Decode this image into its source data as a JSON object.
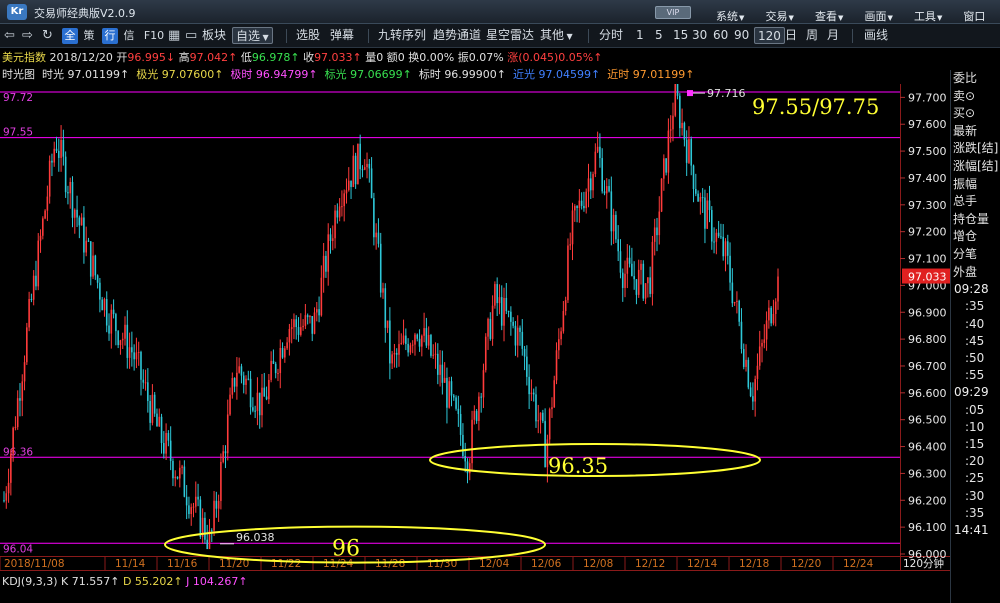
{
  "window": {
    "app_title": "交易师经典版V2.0.9",
    "logo_text": "Kr",
    "vip": "VIP",
    "menu": [
      "系统",
      "交易",
      "查看",
      "画面",
      "工具",
      "窗口"
    ]
  },
  "toolbar": {
    "tabs": [
      "全",
      "策",
      "行",
      "信",
      "F10"
    ],
    "buttons": [
      "板块",
      "自选",
      "选股",
      "弹幕",
      "九转序列",
      "趋势通道",
      "星空雷达",
      "其他"
    ],
    "periods": [
      "分时",
      "1",
      "5",
      "15",
      "30",
      "60",
      "90",
      "120",
      "日",
      "周",
      "月"
    ],
    "selected_period": "120",
    "draw": "画线"
  },
  "info": {
    "name": "美元指数",
    "date": "2018/12/20",
    "open_label": "开",
    "open": "96.995↓",
    "high_label": "高",
    "high": "97.042↑",
    "low_label": "低",
    "low": "96.978↑",
    "close_label": "收",
    "close": "97.033↑",
    "vol_label": "量",
    "vol": "0",
    "amt_label": "额",
    "amt": "0",
    "turn_label": "换",
    "turn": "0.00%",
    "amp_label": "振",
    "amp": "0.07%",
    "chg_label": "涨",
    "chg": "(0.045)0.05%↑"
  },
  "lights": [
    {
      "label": "时光图",
      "value": ""
    },
    {
      "label": "时光",
      "value": "97.01199↑"
    },
    {
      "label": "极光",
      "value": "97.07600↑"
    },
    {
      "label": "极时",
      "value": "96.94799↑"
    },
    {
      "label": "标光",
      "value": "97.06699↑"
    },
    {
      "label": "标时",
      "value": "96.99900↑"
    },
    {
      "label": "近光",
      "value": "97.04599↑"
    },
    {
      "label": "近时",
      "value": "97.01199↑"
    }
  ],
  "right_panel": {
    "items": [
      "委比",
      "卖⊙",
      "买⊙",
      "最新",
      "涨跌[结]",
      "涨幅[结]",
      "振幅",
      "总手",
      "持仓量",
      "增仓",
      "分笔",
      "外盘"
    ],
    "times": [
      "09:28",
      ":35",
      ":40",
      ":45",
      ":50",
      ":55",
      "09:29",
      ":05",
      ":10",
      ":15",
      ":20",
      ":25",
      ":30",
      ":35",
      "14:41"
    ]
  },
  "annotations": {
    "range_text": "97.55/97.75",
    "support_text": "96.35",
    "low_text": "96",
    "high_marker": "97.716",
    "low_marker": "96.038",
    "current_price_tag": "97.033",
    "line_labels": [
      "97.72",
      "97.55",
      "96.36",
      "96.04"
    ]
  },
  "kdj": {
    "name": "KDJ(9,3,3)",
    "k_label": "K",
    "k": "71.557↑",
    "d_label": "D",
    "d": "55.202↑",
    "j_label": "J",
    "j": "104.267↑"
  },
  "colors": {
    "up": "#ff3b3b",
    "down": "#2ec8d8",
    "hline": "#ff00ff",
    "annotation": "#ffff33",
    "axis_text": "#e8e8e8",
    "date_text": "#d07020"
  },
  "chart_data": {
    "type": "candlestick",
    "title": "美元指数",
    "interval": "120分钟",
    "ylim": [
      96.0,
      97.75
    ],
    "yticks": [
      97.7,
      97.6,
      97.5,
      97.4,
      97.3,
      97.2,
      97.1,
      97.0,
      96.9,
      96.8,
      96.7,
      96.6,
      96.5,
      96.4,
      96.3,
      96.2,
      96.1,
      96.0
    ],
    "ytick_labels": [
      "97.700",
      "97.600",
      "97.500",
      "97.400",
      "97.300",
      "97.200",
      "97.100",
      "97.000",
      "96.900",
      "96.800",
      "96.700",
      "96.600",
      "96.500",
      "96.400",
      "96.300",
      "96.200",
      "96.100",
      "96.000"
    ],
    "xticks": [
      "2018/11/08",
      "11/14",
      "11/16",
      "11/20",
      "11/22",
      "11/24",
      "11/28",
      "11/30",
      "12/04",
      "12/06",
      "12/08",
      "12/12",
      "12/14",
      "12/18",
      "12/20",
      "12/24"
    ],
    "x_unit_label": "120分钟",
    "horizontal_lines": [
      97.72,
      97.55,
      96.36,
      96.04
    ],
    "price_path": [
      {
        "date": "11/08",
        "price": 96.2
      },
      {
        "date": "11/09",
        "price": 96.9
      },
      {
        "date": "11/12",
        "price": 97.55
      },
      {
        "date": "11/13",
        "price": 97.2
      },
      {
        "date": "11/14",
        "price": 96.9
      },
      {
        "date": "11/15",
        "price": 96.75
      },
      {
        "date": "11/16",
        "price": 96.45
      },
      {
        "date": "11/19",
        "price": 96.25
      },
      {
        "date": "11/20",
        "price": 96.04
      },
      {
        "date": "11/21",
        "price": 96.7
      },
      {
        "date": "11/22",
        "price": 96.55
      },
      {
        "date": "11/23",
        "price": 96.85
      },
      {
        "date": "11/26",
        "price": 96.85
      },
      {
        "date": "11/27",
        "price": 97.35
      },
      {
        "date": "11/28",
        "price": 97.5
      },
      {
        "date": "11/29",
        "price": 96.7
      },
      {
        "date": "11/30",
        "price": 96.85
      },
      {
        "date": "12/03",
        "price": 96.65
      },
      {
        "date": "12/04",
        "price": 96.36
      },
      {
        "date": "12/05",
        "price": 96.95
      },
      {
        "date": "12/06",
        "price": 96.8
      },
      {
        "date": "12/07",
        "price": 96.38
      },
      {
        "date": "12/10",
        "price": 97.2
      },
      {
        "date": "12/11",
        "price": 97.5
      },
      {
        "date": "12/12",
        "price": 97.05
      },
      {
        "date": "12/13",
        "price": 97.0
      },
      {
        "date": "12/14",
        "price": 97.716
      },
      {
        "date": "12/17",
        "price": 97.3
      },
      {
        "date": "12/18",
        "price": 97.1
      },
      {
        "date": "12/19",
        "price": 96.6
      },
      {
        "date": "12/20",
        "price": 97.033
      }
    ]
  }
}
